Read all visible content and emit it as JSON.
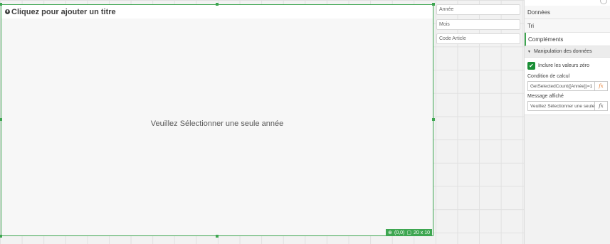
{
  "object": {
    "title_placeholder": "Cliquez pour ajouter un titre",
    "message": "Veuillez Sélectionner une seule année",
    "position_badge": "(0,0)",
    "size_badge": "20 x 10"
  },
  "filters": [
    "Année",
    "Mois",
    "Code Article"
  ],
  "panel": {
    "sections": [
      "Données",
      "Tri",
      "Compléments"
    ],
    "subsection": "Manipulation des données",
    "include_zero_label": "Inclure les valeurs zéro",
    "include_zero_checked": true,
    "condition_label": "Condition de calcul",
    "condition_value": "GetSelectedCount([Année])=1",
    "message_label": "Message affiché",
    "message_value": "Veuillez Sélectionner une seule année",
    "fx_label": "fx"
  },
  "colors": {
    "accent": "#3ea651",
    "checkbox": "#1a8f36",
    "fx_active": "#e27b2c"
  }
}
